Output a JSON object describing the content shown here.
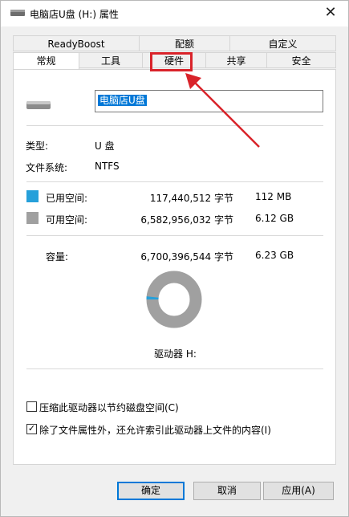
{
  "window": {
    "title": "电脑店U盘 (H:) 属性",
    "close": "✕"
  },
  "tabs_row1": [
    "ReadyBoost",
    "配额",
    "自定义"
  ],
  "tabs_row2": [
    "常规",
    "工具",
    "硬件",
    "共享",
    "安全"
  ],
  "active_tab": "常规",
  "general": {
    "drive_name": "电脑店U盘",
    "type_label": "类型:",
    "type_value": "U 盘",
    "fs_label": "文件系统:",
    "fs_value": "NTFS",
    "used_label": "已用空间:",
    "used_bytes": "117,440,512 字节",
    "used_size": "112 MB",
    "free_label": "可用空间:",
    "free_bytes": "6,582,956,032 字节",
    "free_size": "6.12 GB",
    "capacity_label": "容量:",
    "capacity_bytes": "6,700,396,544 字节",
    "capacity_size": "6.23 GB",
    "drive_label": "驱动器 H:",
    "used_fraction": 0.0175,
    "used_color": "#26a0da",
    "free_color": "#a0a0a0",
    "compress_label": "压缩此驱动器以节约磁盘空间(C)",
    "compress_checked": false,
    "index_label": "除了文件属性外，还允许索引此驱动器上文件的内容(I)",
    "index_checked": true
  },
  "buttons": {
    "ok": "确定",
    "cancel": "取消",
    "apply": "应用(A)"
  },
  "annotation_color": "#d9232a"
}
